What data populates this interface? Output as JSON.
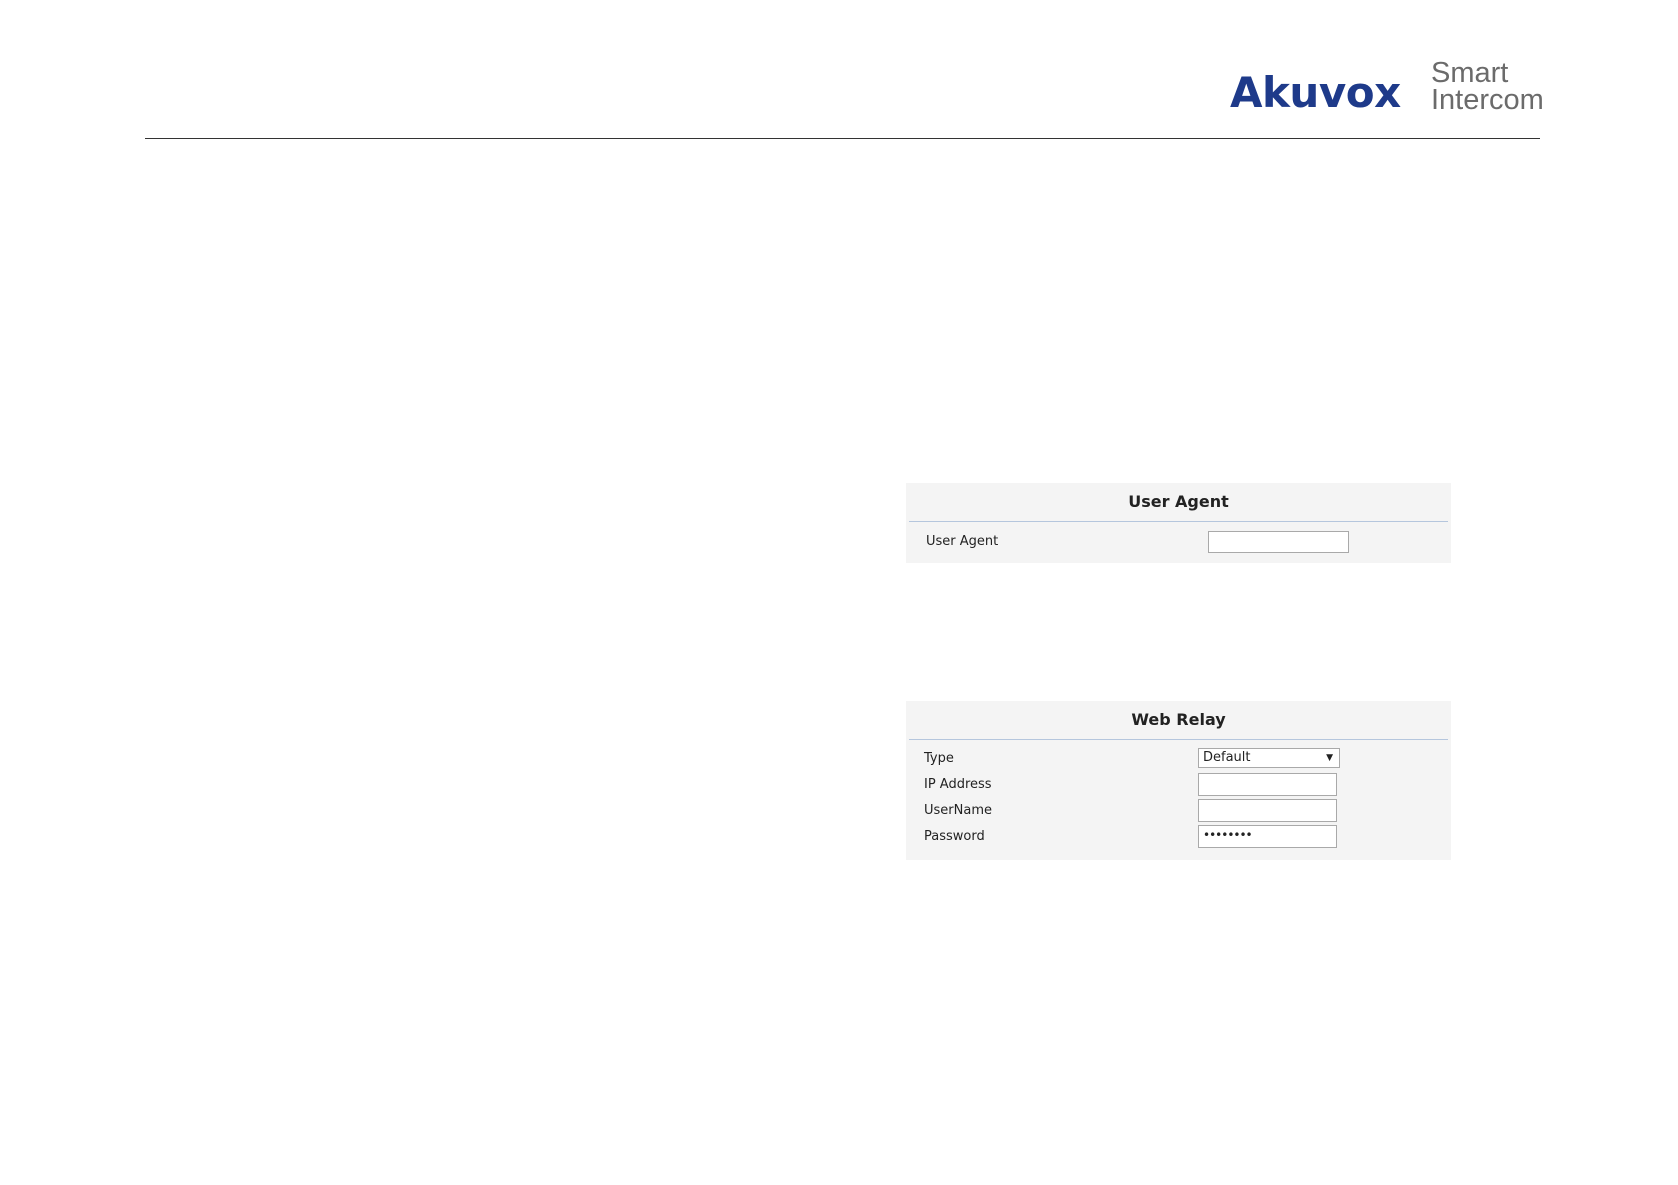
{
  "brand": {
    "name": "Akuvox",
    "tagline_line1": "Smart",
    "tagline_line2": "Intercom"
  },
  "user_agent_panel": {
    "title": "User Agent",
    "rows": [
      {
        "label": "User Agent",
        "value": ""
      }
    ]
  },
  "web_relay_panel": {
    "title": "Web Relay",
    "type": {
      "label": "Type",
      "selected": "Default"
    },
    "ip_address": {
      "label": "IP Address",
      "value": ""
    },
    "username": {
      "label": "UserName",
      "value": ""
    },
    "password": {
      "label": "Password",
      "masked_value": "••••••••"
    }
  },
  "colors": {
    "brand_blue": "#1e3a8a",
    "brand_gray": "#6b6b6b",
    "panel_background": "#f4f4f4",
    "title_divider": "#b5c6dd"
  }
}
